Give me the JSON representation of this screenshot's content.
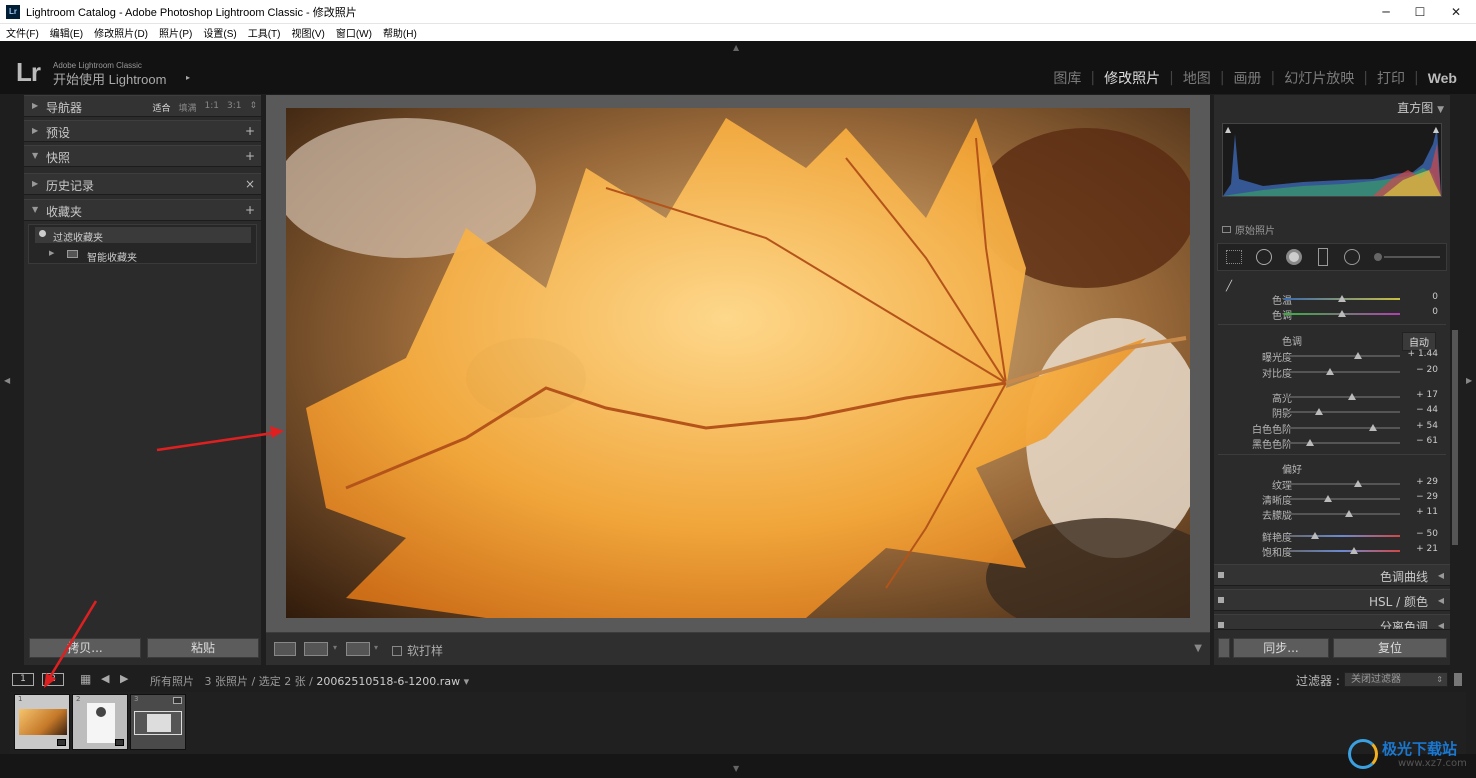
{
  "window": {
    "title": "Lightroom Catalog - Adobe Photoshop Lightroom Classic - 修改照片",
    "app_icon": "Lr",
    "controls": [
      "─",
      "☐",
      "✕"
    ]
  },
  "menu": [
    "文件(F)",
    "编辑(E)",
    "修改照片(D)",
    "照片(P)",
    "设置(S)",
    "工具(T)",
    "视图(V)",
    "窗口(W)",
    "帮助(H)"
  ],
  "identity": {
    "logo": "Lr",
    "small": "Adobe Lightroom Classic",
    "big": "开始使用 Lightroom",
    "arrow": "▸"
  },
  "modules": [
    {
      "label": "图库",
      "active": false
    },
    {
      "label": "修改照片",
      "active": true
    },
    {
      "label": "地图",
      "active": false
    },
    {
      "label": "画册",
      "active": false
    },
    {
      "label": "幻灯片放映",
      "active": false
    },
    {
      "label": "打印",
      "active": false
    },
    {
      "label": "Web",
      "active": false
    }
  ],
  "left_panel": {
    "navigator": {
      "label": "导航器",
      "zoom_options": [
        "适合",
        "填满",
        "1:1",
        "3:1"
      ],
      "selected_zoom": "适合"
    },
    "presets": {
      "label": "预设",
      "action": "+"
    },
    "snapshots": {
      "label": "快照",
      "action": "+"
    },
    "history": {
      "label": "历史记录",
      "action": "×"
    },
    "collections": {
      "label": "收藏夹",
      "action": "+",
      "filter_placeholder": "过滤收藏夹",
      "items": [
        {
          "label": "智能收藏夹"
        }
      ]
    },
    "copy_button": "拷贝...",
    "paste_button": "粘贴"
  },
  "toolbar": {
    "soft_proof_label": "软打样",
    "soft_proof_checked": false
  },
  "right_panel": {
    "histogram_title": "直方图",
    "original_photo_label": "原始照片",
    "wb_sliders": [
      {
        "label": "色温",
        "value": "0",
        "pos": 0.5
      },
      {
        "label": "色调",
        "value": "0",
        "pos": 0.5
      }
    ],
    "tone": {
      "title": "色调",
      "auto_label": "自动",
      "sliders": [
        {
          "label": "曝光度",
          "value": "+ 1.44",
          "pos": 0.64
        },
        {
          "label": "对比度",
          "value": "− 20",
          "pos": 0.4
        },
        {
          "label": "高光",
          "value": "+ 17",
          "pos": 0.59
        },
        {
          "label": "阴影",
          "value": "− 44",
          "pos": 0.3
        },
        {
          "label": "白色色阶",
          "value": "+ 54",
          "pos": 0.77
        },
        {
          "label": "黑色色阶",
          "value": "− 61",
          "pos": 0.22
        }
      ]
    },
    "presence": {
      "title": "偏好",
      "sliders": [
        {
          "label": "纹理",
          "value": "+ 29",
          "pos": 0.64
        },
        {
          "label": "清晰度",
          "value": "− 29",
          "pos": 0.38
        },
        {
          "label": "去朦胧",
          "value": "+ 11",
          "pos": 0.56
        },
        {
          "label": "鲜艳度",
          "value": "− 50",
          "pos": 0.27
        },
        {
          "label": "饱和度",
          "value": "+ 21",
          "pos": 0.6
        }
      ]
    },
    "collapsed_panels": [
      {
        "label": "色调曲线"
      },
      {
        "label": "HSL / 颜色"
      },
      {
        "label": "分离色调"
      }
    ],
    "sync_button": "同步...",
    "reset_button": "复位"
  },
  "filmstrip_bar": {
    "view_buttons": [
      "1",
      "2"
    ],
    "source": "所有照片",
    "count": "3 张照片 / 选定 2 张 /",
    "filename": "20062510518-6-1200.raw",
    "filter_label": "过滤器 :",
    "filter_value": "关闭过滤器"
  },
  "filmstrip": [
    {
      "index": "1",
      "selected": true
    },
    {
      "index": "2",
      "selected": true
    },
    {
      "index": "3",
      "selected": false
    }
  ],
  "watermark": "极光下载站",
  "watermark_url": "www.xz7.com"
}
